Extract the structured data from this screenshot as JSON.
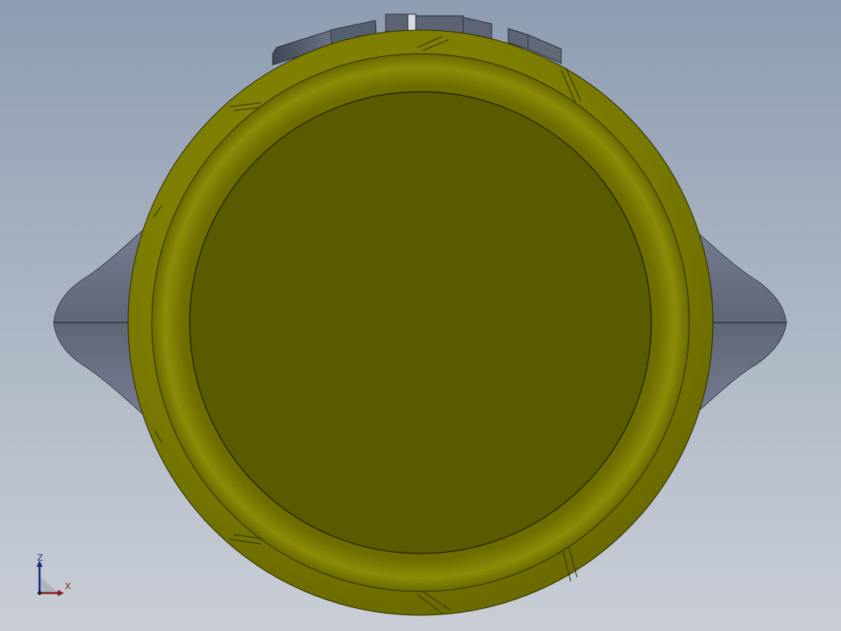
{
  "view": {
    "background_top": "#8e9db2",
    "background_bottom": "#c9ced6"
  },
  "model": {
    "body_color": "#7f7f00",
    "face_color": "#5a5a00",
    "rim_color": "#8a8a06",
    "handle_color": "#6f7688",
    "edge_color": "#1c1c1c"
  },
  "triad": {
    "z_label": "Z",
    "x_label": "X",
    "z_color": "#1a2a88",
    "x_color": "#8a1a1a"
  }
}
